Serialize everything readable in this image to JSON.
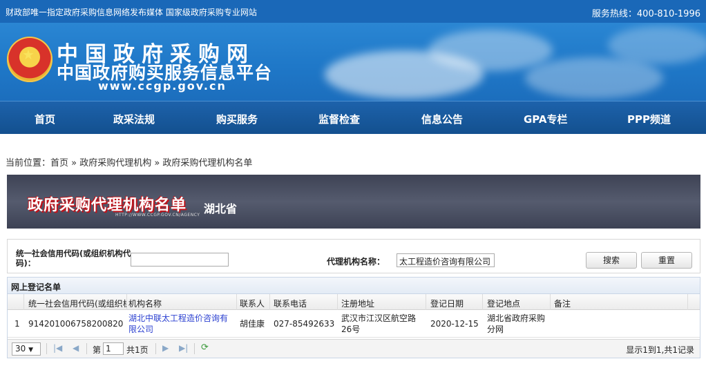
{
  "topbar": {
    "left_text": "财政部唯一指定政府采购信息网络发布媒体 国家级政府采购专业网站",
    "hotline": "服务热线：400-810-1996"
  },
  "header": {
    "logo_line1": "中国政府采购网",
    "logo_line2": "中国政府购买服务信息平台",
    "logo_url": "www.ccgp.gov.cn"
  },
  "nav": {
    "items": [
      "首页",
      "政采法规",
      "购买服务",
      "监督检查",
      "信息公告",
      "GPA专栏",
      "PPP频道"
    ]
  },
  "breadcrumb": "当前位置：首页 » 政府采购代理机构 » 政府采购代理机构名单",
  "panel": {
    "title": "政府采购代理机构名单",
    "province": "湖北省",
    "url": "HTTP://WWW.CCGP.GOV.CN/AGENCY"
  },
  "search": {
    "credit_label": "统一社会信用代码(或组织机构代码)：",
    "credit_value": "",
    "name_label": "代理机构名称：",
    "name_value": "太工程造价咨询有限公司",
    "search_button": "搜索",
    "reset_button": "重置"
  },
  "grid": {
    "title": "网上登记名单",
    "headers": [
      "统一社会信用代码(或组织机构代码)",
      "机构名称",
      "联系人",
      "联系电话",
      "注册地址",
      "登记日期",
      "登记地点",
      "备注"
    ],
    "rows": [
      {
        "index": "1",
        "code": "914201006758200820",
        "name": "湖北中联太工程造价咨询有限公司",
        "contact": "胡佳康",
        "phone": "027-85492633",
        "address": "武汉市江汉区航空路26号",
        "date": "2020-12-15",
        "place": "湖北省政府采购分网",
        "remark": ""
      }
    ]
  },
  "pager": {
    "page_size": "30",
    "page_prefix": "第",
    "page_number": "1",
    "page_suffix": "共1页",
    "info": "显示1到1,共1记录"
  }
}
